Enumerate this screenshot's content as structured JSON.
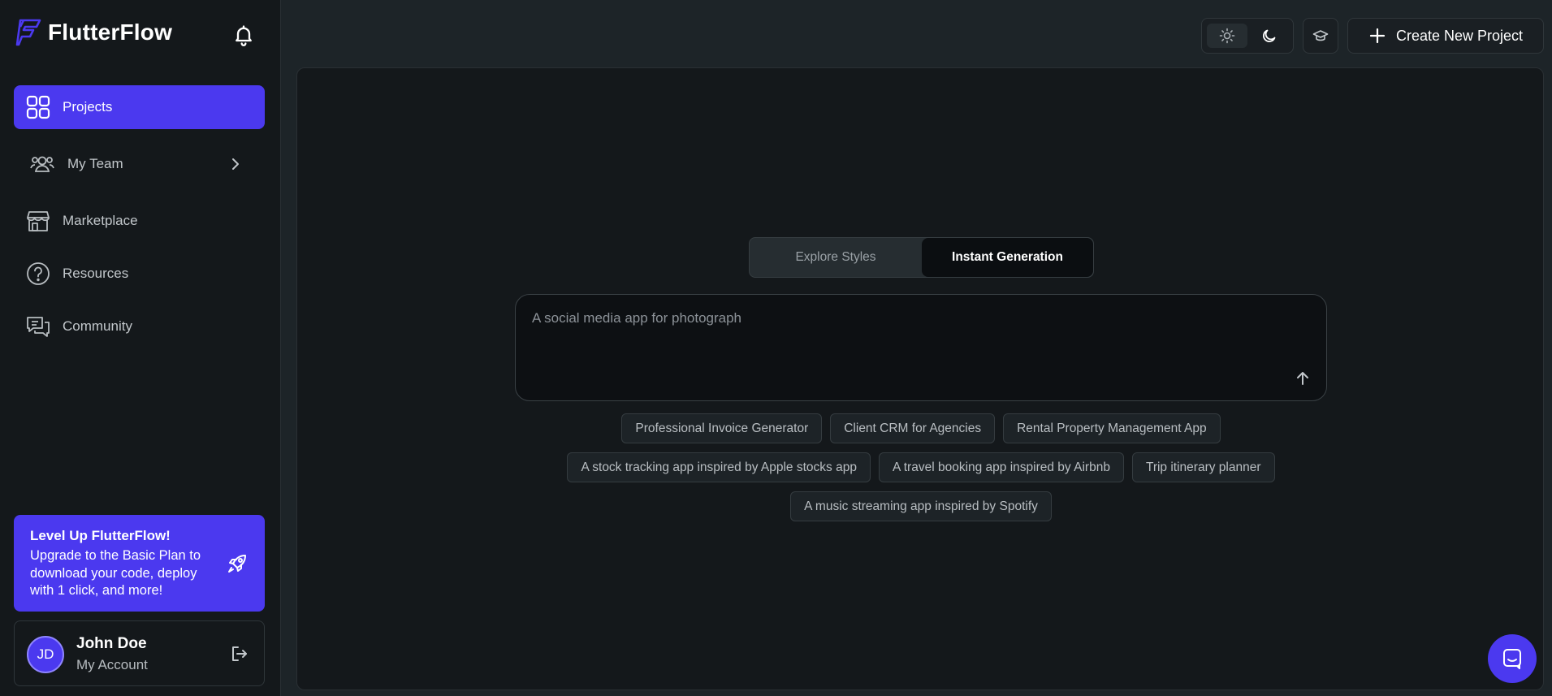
{
  "brand": {
    "name": "FlutterFlow",
    "accent": "#4b39ef"
  },
  "sidebar": {
    "items": [
      {
        "label": "Projects",
        "icon": "grid-icon",
        "active": true
      },
      {
        "label": "My Team",
        "icon": "team-icon"
      },
      {
        "label": "Marketplace",
        "icon": "store-icon"
      },
      {
        "label": "Resources",
        "icon": "help-circle-icon"
      },
      {
        "label": "Community",
        "icon": "chat-bubbles-icon"
      }
    ],
    "promo": {
      "title": "Level Up FlutterFlow!",
      "text": "Upgrade to the Basic Plan to download your code, deploy with 1 click, and more!"
    },
    "account": {
      "initials": "JD",
      "name": "John Doe",
      "subtitle": "My Account"
    }
  },
  "topbar": {
    "create_label": "Create New Project"
  },
  "main": {
    "tabs": [
      {
        "label": "Explore Styles",
        "active": false
      },
      {
        "label": "Instant Generation",
        "active": true
      }
    ],
    "prompt_placeholder": "A social media app for photograph",
    "suggestions": [
      [
        "Professional Invoice Generator",
        "Client CRM for Agencies",
        "Rental Property Management App"
      ],
      [
        "A stock tracking app inspired by Apple stocks app",
        "A travel booking app inspired by Airbnb",
        "Trip itinerary planner"
      ],
      [
        "A music streaming app inspired by Spotify"
      ]
    ]
  }
}
